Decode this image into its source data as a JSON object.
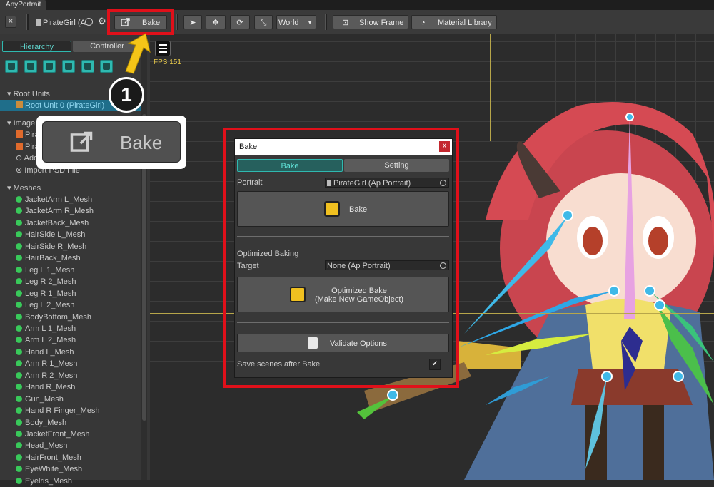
{
  "app": {
    "tab_title": "AnyPortrait"
  },
  "toolbar": {
    "close_label": "×",
    "portrait_name": "PirateGirl (A",
    "bake_label": "Bake",
    "space_select": "World",
    "show_frame_label": "Show Frame",
    "material_library_label": "Material Library"
  },
  "left": {
    "tabs": [
      "Hierarchy",
      "Controller"
    ],
    "fps": "FPS 151",
    "root_units_header": "Root Units",
    "root_unit_item": "Root Unit 0 (PirateGirl)",
    "images_header": "Image",
    "image_items": [
      "Pira",
      "Pira",
      "Add",
      "Import PSD File"
    ],
    "meshes_header": "Meshes",
    "meshes": [
      "JacketArm L_Mesh",
      "JacketArm R_Mesh",
      "JacketBack_Mesh",
      "HairSide L_Mesh",
      "HairSide R_Mesh",
      "HairBack_Mesh",
      "Leg L 1_Mesh",
      "Leg R 2_Mesh",
      "Leg R 1_Mesh",
      "Leg L 2_Mesh",
      "BodyBottom_Mesh",
      "Arm L 1_Mesh",
      "Arm L 2_Mesh",
      "Hand L_Mesh",
      "Arm R 1_Mesh",
      "Arm R 2_Mesh",
      "Hand R_Mesh",
      "Gun_Mesh",
      "Hand R Finger_Mesh",
      "Body_Mesh",
      "JacketFront_Mesh",
      "Head_Mesh",
      "HairFront_Mesh",
      "EyeWhite_Mesh",
      "Eyelris_Mesh"
    ]
  },
  "callout": {
    "step_number": "1",
    "zoom_label": "Bake"
  },
  "dialog": {
    "title": "Bake",
    "close_label": "x",
    "tabs": [
      "Bake",
      "Setting"
    ],
    "portrait_label": "Portrait",
    "portrait_value": "PirateGirl (Ap Portrait)",
    "bake_button": "Bake",
    "optimized_section": "Optimized Baking",
    "target_label": "Target",
    "target_value": "None (Ap Portrait)",
    "optimized_button_line1": "Optimized Bake",
    "optimized_button_line2": "(Make New GameObject)",
    "validate_button": "Validate Options",
    "save_scenes_label": "Save scenes after Bake",
    "save_scenes_checked": "✔"
  },
  "colors": {
    "accent_teal": "#2fb9b0",
    "highlight_red": "#e0101a",
    "arrow_yellow": "#f5c518"
  }
}
